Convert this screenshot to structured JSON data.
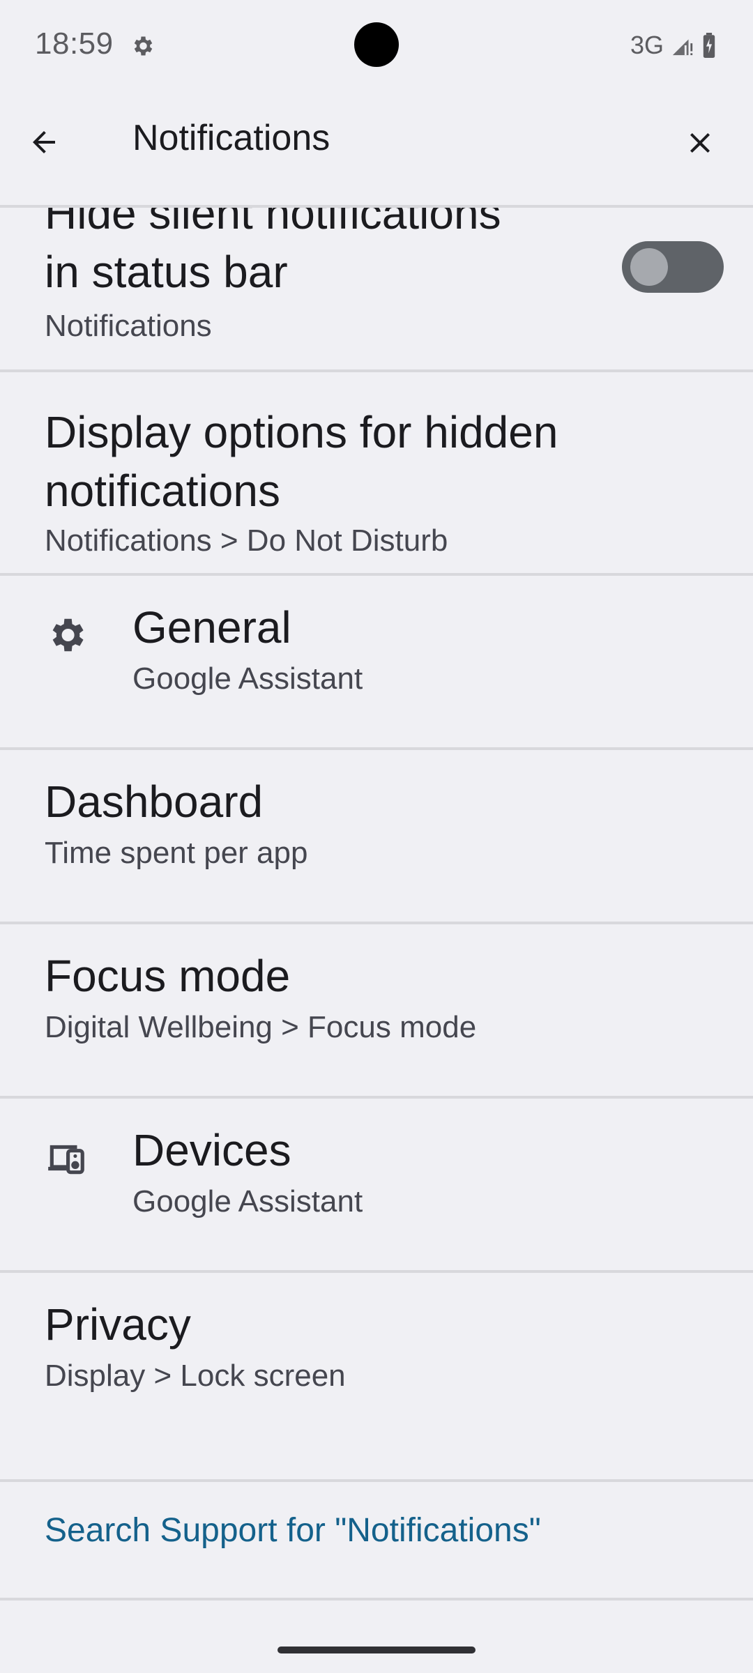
{
  "status_bar": {
    "time": "18:59",
    "network": "3G",
    "icons": [
      "gear-icon",
      "signal-icon",
      "battery-icon"
    ]
  },
  "header": {
    "query": "Notifications",
    "back_icon": "back-arrow-icon",
    "clear_icon": "close-icon"
  },
  "results": [
    {
      "title_line1": "Hide silent notifications",
      "title_line2": "in status bar",
      "subtitle": "Notifications",
      "toggle_on": false
    },
    {
      "title_line1": "Display options for hidden",
      "title_line2": "notifications",
      "subtitle": "Notifications > Do Not Disturb"
    },
    {
      "title": "General",
      "subtitle": "Google Assistant",
      "icon": "gear-icon"
    },
    {
      "title": "Dashboard",
      "subtitle": "Time spent per app"
    },
    {
      "title": "Focus mode",
      "subtitle": "Digital Wellbeing > Focus mode"
    },
    {
      "title": "Devices",
      "subtitle": "Google Assistant",
      "icon": "devices-icon"
    },
    {
      "title": "Privacy",
      "subtitle": "Display > Lock screen"
    }
  ],
  "support": {
    "label": "Search Support for \"Notifications\""
  },
  "colors": {
    "background": "#f0f0f4",
    "link": "#14618b",
    "toggle_track": "#5f6368",
    "toggle_thumb": "#a6a9ae"
  }
}
